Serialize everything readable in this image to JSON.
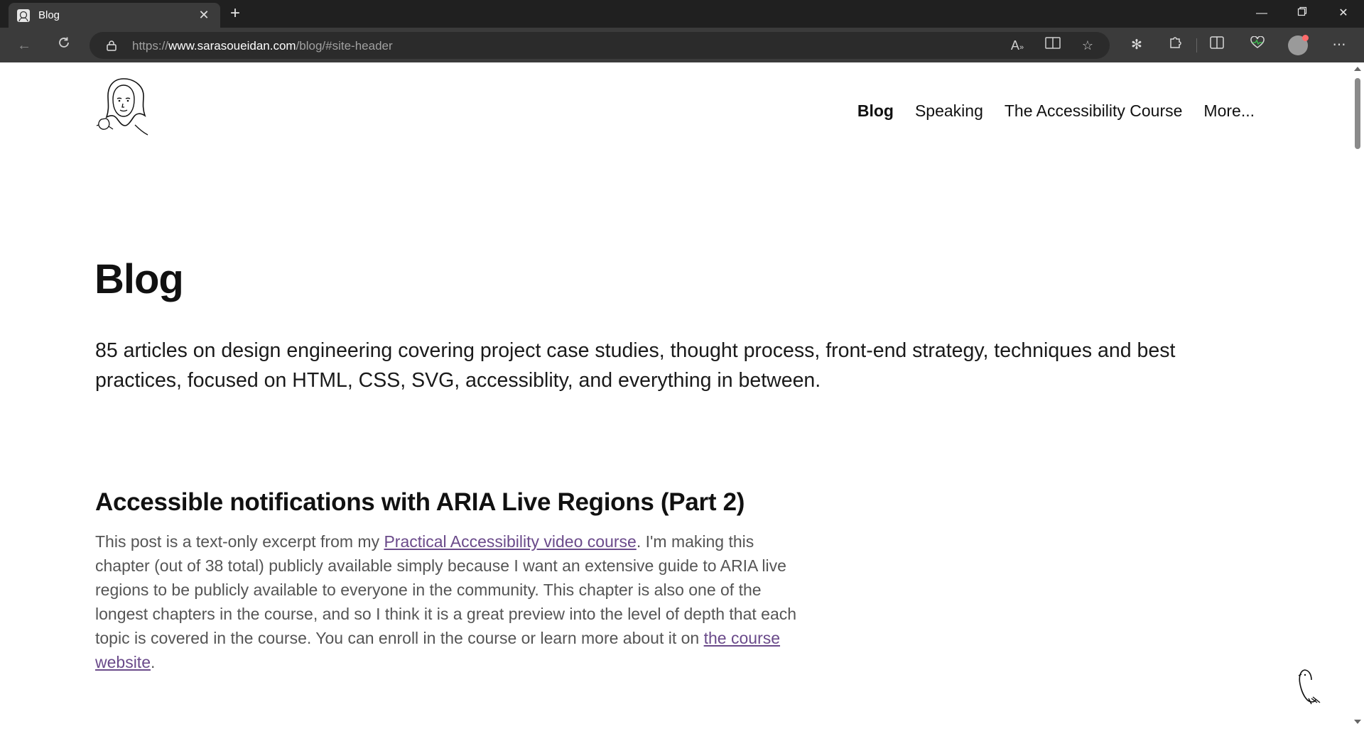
{
  "browser": {
    "tab": {
      "title": "Blog",
      "favicon": "face-favicon-icon"
    },
    "url": {
      "prefix": "https://",
      "host": "www.sarasoueidan.com",
      "path": "/blog/#site-header"
    },
    "icons": {
      "read_aloud": "read-aloud-icon",
      "immersive_reader": "immersive-reader-icon",
      "favorite": "star-icon",
      "copilot": "copilot-icon",
      "extensions": "puzzle-icon",
      "split_screen": "split-screen-icon",
      "health": "heartbeat-icon",
      "profile": "profile-icon",
      "more": "ellipsis-icon"
    }
  },
  "site": {
    "nav": {
      "items": [
        {
          "label": "Blog",
          "active": true
        },
        {
          "label": "Speaking",
          "active": false
        },
        {
          "label": "The Accessibility Course",
          "active": false
        },
        {
          "label": "More...",
          "active": false
        }
      ]
    }
  },
  "main": {
    "title": "Blog",
    "intro": "85 articles on design engineering covering project case studies, thought process, front-end strategy, techniques and best practices, focused on HTML, CSS, SVG, accessiblity, and everything in between.",
    "posts": [
      {
        "title": "Accessible notifications with ARIA Live Regions (Part 2)",
        "excerpt_before": "This post is a text-only excerpt from my ",
        "link1": "Practical Accessibility video course",
        "excerpt_middle": ". I'm making this chapter (out of 38 total) publicly available simply because I want an extensive guide to ARIA live regions to be publicly available to everyone in the community. This chapter is also one of the longest chapters in the course, and so I think it is a great preview into the level of depth that each topic is covered in the course. You can enroll in the course or learn more about it on ",
        "link2": "the course website",
        "excerpt_after": "."
      }
    ]
  }
}
